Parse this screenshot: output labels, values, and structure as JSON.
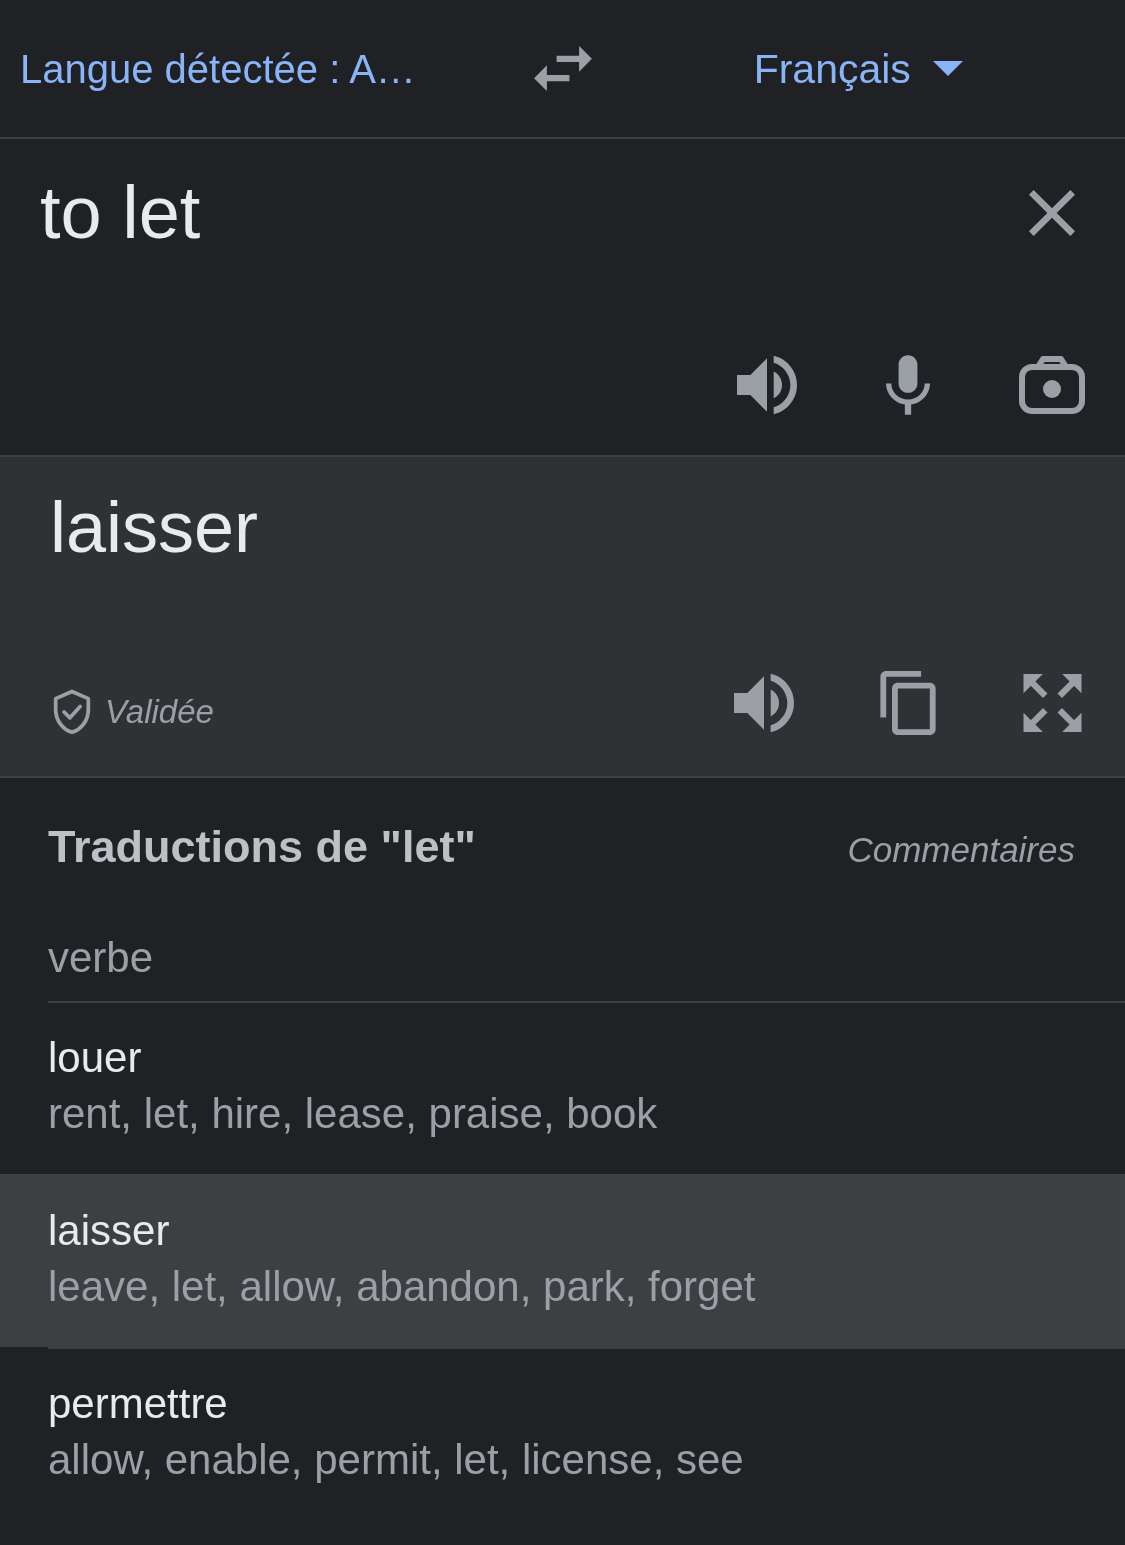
{
  "language_bar": {
    "source_language": "Langue détectée : A…",
    "target_language": "Français"
  },
  "input": {
    "value": "to let"
  },
  "output": {
    "text": "laisser",
    "status": "Validée"
  },
  "dictionary": {
    "title": "Traductions de \"let\"",
    "feedback_link": "Commentaires",
    "part_of_speech": "verbe",
    "entries": [
      {
        "word": "louer",
        "synonyms": "rent, let, hire, lease, praise, book",
        "selected": false
      },
      {
        "word": "laisser",
        "synonyms": "leave, let, allow, abandon, park, forget",
        "selected": true
      },
      {
        "word": "permettre",
        "synonyms": "allow, enable, permit, let, license, see",
        "selected": false
      }
    ]
  }
}
